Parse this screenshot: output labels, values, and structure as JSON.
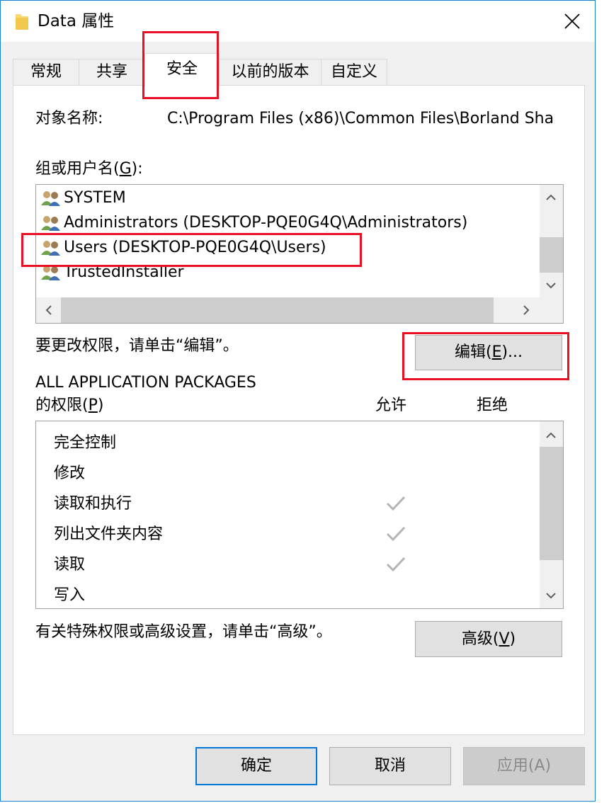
{
  "window": {
    "title": "Data 属性",
    "icon": "folder-icon",
    "close_icon": "close-icon"
  },
  "tabs": [
    {
      "label": "常规",
      "active": false
    },
    {
      "label": "共享",
      "active": false
    },
    {
      "label": "安全",
      "active": true
    },
    {
      "label": "以前的版本",
      "active": false
    },
    {
      "label": "自定义",
      "active": false
    }
  ],
  "security": {
    "object_name_label": "对象名称:",
    "object_name_value": "C:\\Program Files (x86)\\Common Files\\Borland Sha",
    "groups_label_prefix": "组或用户名(",
    "groups_label_key": "G",
    "groups_label_suffix": "):",
    "groups": [
      {
        "name": "SYSTEM",
        "icon": "user-group-icon"
      },
      {
        "name": "Administrators (DESKTOP-PQE0G4Q\\Administrators)",
        "icon": "user-group-icon"
      },
      {
        "name": "Users (DESKTOP-PQE0G4Q\\Users)",
        "icon": "user-group-icon"
      },
      {
        "name": "TrustedInstaller",
        "icon": "user-group-icon"
      }
    ],
    "edit_hint": "要更改权限，请单击“编辑”。",
    "edit_button_prefix": "编辑(",
    "edit_button_key": "E",
    "edit_button_suffix": ")...",
    "permissions_for": "ALL APPLICATION PACKAGES",
    "permissions_label_prefix": "的权限(",
    "permissions_label_key": "P",
    "permissions_label_suffix": ")",
    "allow_header": "允许",
    "deny_header": "拒绝",
    "permissions": [
      {
        "name": "完全控制",
        "allow": false,
        "deny": false
      },
      {
        "name": "修改",
        "allow": false,
        "deny": false
      },
      {
        "name": "读取和执行",
        "allow": true,
        "deny": false
      },
      {
        "name": "列出文件夹内容",
        "allow": true,
        "deny": false
      },
      {
        "name": "读取",
        "allow": true,
        "deny": false
      },
      {
        "name": "写入",
        "allow": false,
        "deny": false
      }
    ],
    "advanced_hint": "有关特殊权限或高级设置，请单击“高级”。",
    "advanced_button_prefix": "高级(",
    "advanced_button_key": "V",
    "advanced_button_suffix": ")"
  },
  "footer": {
    "ok": "确定",
    "cancel": "取消",
    "apply": "应用(A)"
  },
  "colors": {
    "highlight_box": "#e81123",
    "accent": "#0078d7",
    "check": "#b4b4b4"
  }
}
